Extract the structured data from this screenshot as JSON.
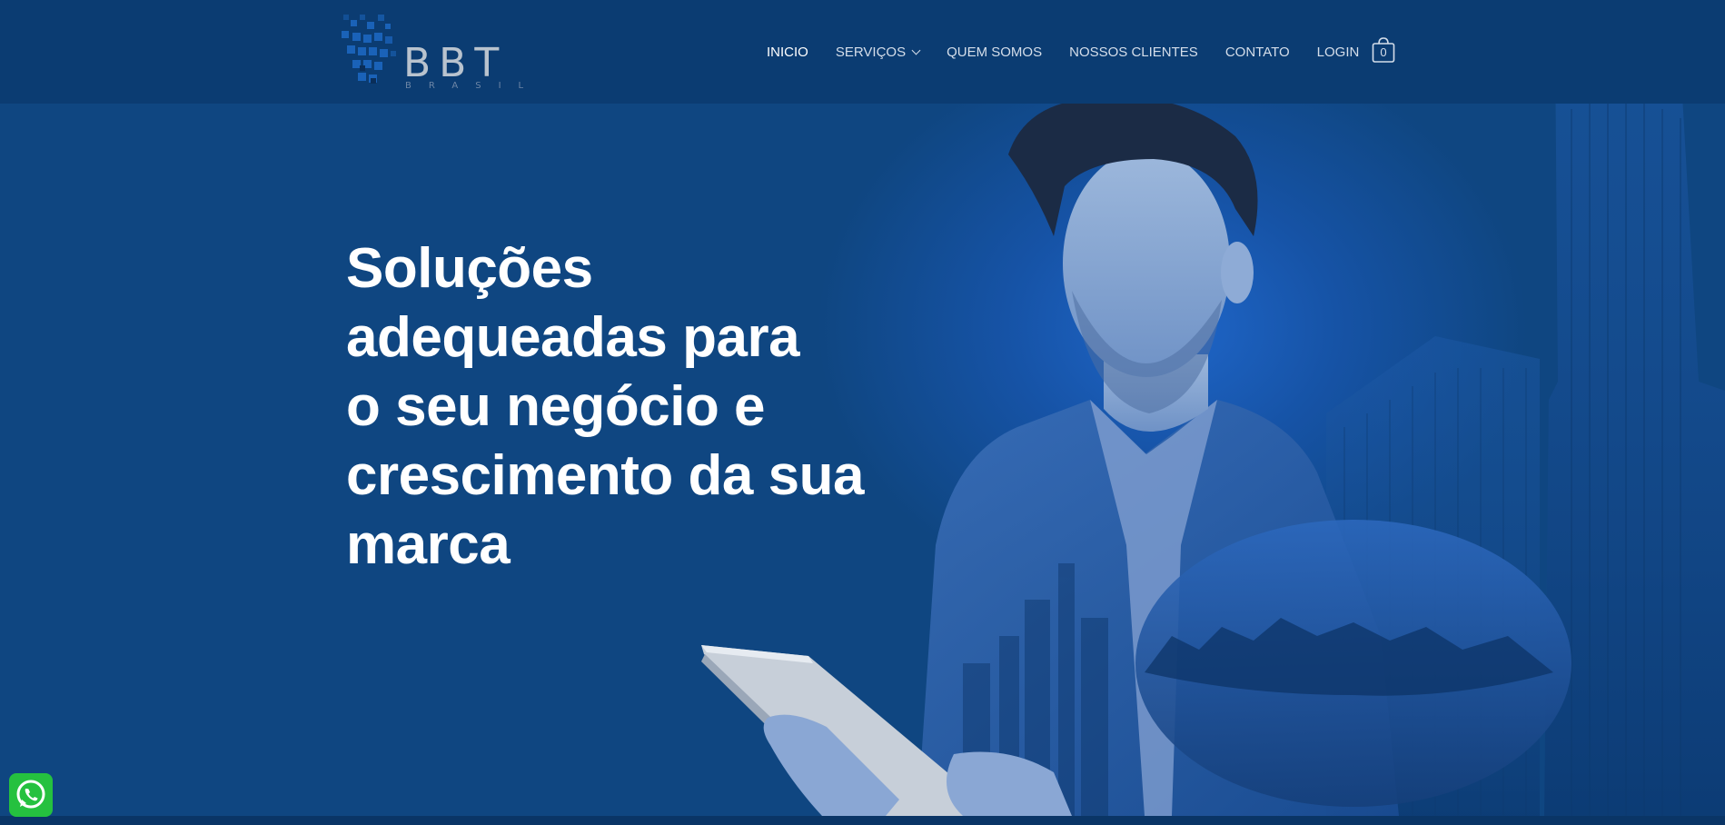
{
  "brand": {
    "name": "BBT",
    "sub": "BRASIL"
  },
  "nav": {
    "items": [
      {
        "label": "INICIO",
        "active": true
      },
      {
        "label": "SERVIÇOS",
        "dropdown": true
      },
      {
        "label": "QUEM SOMOS"
      },
      {
        "label": "NOSSOS CLIENTES"
      },
      {
        "label": "CONTATO"
      },
      {
        "label": "LOGIN"
      }
    ],
    "cart_count": "0"
  },
  "hero": {
    "headline_lines": [
      "Soluções",
      "adequeadas para",
      "o seu negócio e",
      "crescimento da sua",
      "marca"
    ]
  },
  "colors": {
    "background": "#0f4681",
    "header": "#0b3c72",
    "whatsapp": "#25c13f",
    "text": "#ffffff"
  },
  "icons": {
    "cart": "shopping-bag-icon",
    "dropdown": "chevron-down-icon",
    "chat": "whatsapp-icon"
  }
}
